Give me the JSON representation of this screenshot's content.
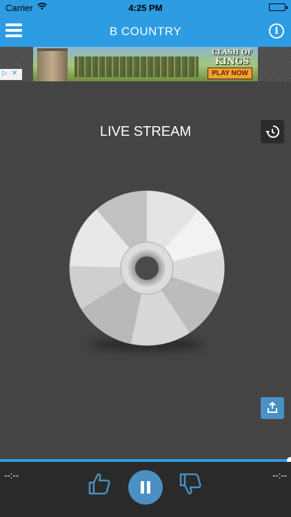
{
  "status_bar": {
    "carrier": "Carrier",
    "time": "4:25 PM"
  },
  "nav": {
    "title": "B COUNTRY",
    "info_glyph": "i",
    "menu_icon": "hamburger-menu-icon",
    "info_icon": "info-icon"
  },
  "ad": {
    "choices_icons": [
      "ad-info-icon",
      "ad-close-icon"
    ],
    "logo_line1": "CLASH OF",
    "logo_line2": "KINGS",
    "cta": "PLAY NOW"
  },
  "player": {
    "title": "LIVE STREAM",
    "history_icon": "history-icon",
    "share_icon": "share-icon",
    "progress": 1.0
  },
  "controls": {
    "elapsed": "--:--",
    "remaining": "--:--",
    "like_icon": "thumbs-up-icon",
    "pause_icon": "pause-icon",
    "dislike_icon": "thumbs-down-icon"
  },
  "colors": {
    "accent": "#2d9ce3",
    "button_blue": "#4a90c2",
    "panel": "#444444",
    "footer": "#2a2a2a"
  }
}
